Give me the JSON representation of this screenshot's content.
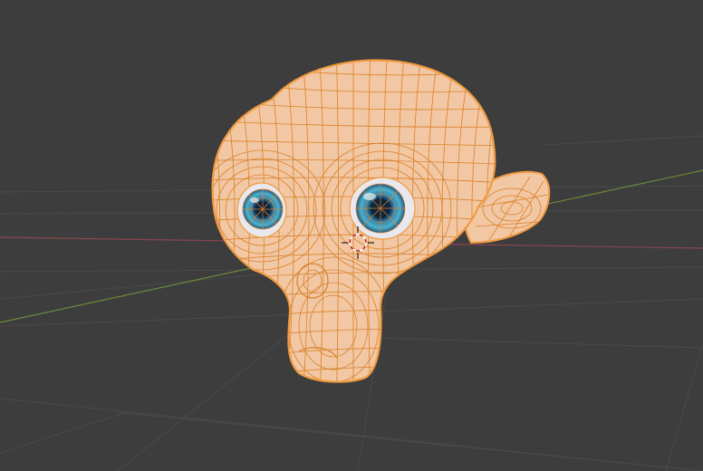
{
  "viewport": {
    "background": "#3d3d3d",
    "grid_color": "#4a4a4a",
    "x_axis_color": "#8a4650",
    "y_axis_color": "#6a8a3a"
  },
  "object": {
    "icon": "monkey-mesh-icon",
    "skin_color": "#f2c7a3",
    "wire_color": "#d9822b",
    "outline_color": "#f09a40",
    "eye_iris_color": "#2a7fb0",
    "eye_pupil_color": "#10243a"
  },
  "cursor_3d": {
    "icon": "3d-cursor-icon",
    "ring_color_a": "#c03030",
    "ring_color_b": "#ffffff"
  }
}
